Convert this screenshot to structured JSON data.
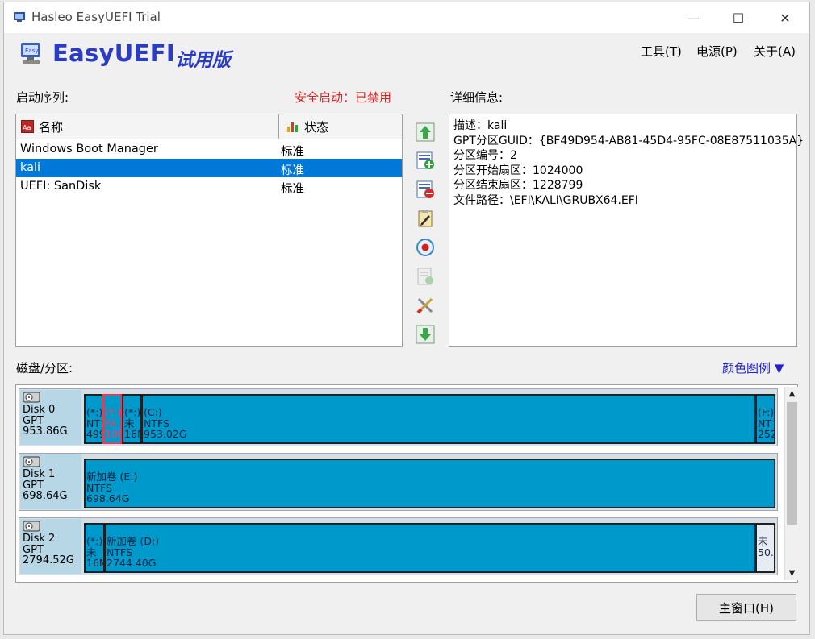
{
  "window": {
    "title": "Hasleo EasyUEFI Trial",
    "controls": {
      "minimize": "—",
      "maximize": "☐",
      "close": "✕"
    }
  },
  "header": {
    "brand": "EasyUEFI",
    "brand_suffix": "试用版",
    "menu": [
      "工具(T)",
      "电源(P)",
      "关于(A)"
    ]
  },
  "boot": {
    "label": "启动序列:",
    "secure_boot": "安全启动：已禁用",
    "columns": {
      "name": "名称",
      "status": "状态"
    },
    "entries": [
      {
        "name": "Windows Boot Manager",
        "status": "标准"
      },
      {
        "name": "kali",
        "status": "标准",
        "selected": true
      },
      {
        "name": "UEFI: SanDisk",
        "status": "标准"
      }
    ]
  },
  "toolbar": {
    "icons": [
      "move-up-icon",
      "add-entry-icon",
      "delete-entry-icon",
      "edit-entry-icon",
      "set-one-time-boot-icon",
      "backup-icon",
      "tools-icon",
      "move-down-icon"
    ]
  },
  "details": {
    "label": "详细信息:",
    "lines": [
      "描述：kali",
      "GPT分区GUID：{BF49D954-AB81-45D4-95FC-08E87511035A}",
      "分区编号：2",
      "分区开始扇区：1024000",
      "分区结束扇区：1228799",
      "文件路径：\\EFI\\KALI\\GRUBX64.EFI"
    ]
  },
  "disks": {
    "label": "磁盘/分区:",
    "legend_link": "颜色图例 ▼",
    "list": [
      {
        "name": "Disk 0",
        "type": "GPT",
        "size": "953.86G",
        "partitions": [
          {
            "label": "(*:)",
            "fs": "NT",
            "size": "499",
            "kind": "normal"
          },
          {
            "label": "(*:)",
            "fs": "FA",
            "size": "100",
            "kind": "fat"
          },
          {
            "label": "(*:)",
            "fs": "未",
            "size": "16M",
            "kind": "normal"
          },
          {
            "label": "(C:)",
            "fs": "NTFS",
            "size": "953.02G",
            "kind": "normal"
          },
          {
            "label": "(F:)",
            "fs": "NT",
            "size": "252",
            "kind": "normal"
          }
        ]
      },
      {
        "name": "Disk 1",
        "type": "GPT",
        "size": "698.64G",
        "partitions": [
          {
            "label": "新加卷 (E:)",
            "fs": "NTFS",
            "size": "698.64G",
            "kind": "normal"
          }
        ]
      },
      {
        "name": "Disk 2",
        "type": "GPT",
        "size": "2794.52G",
        "partitions": [
          {
            "label": "(*:)",
            "fs": "未",
            "size": "16M",
            "kind": "normal"
          },
          {
            "label": "新加卷 (D:)",
            "fs": "NTFS",
            "size": "2744.40G",
            "kind": "normal"
          },
          {
            "label": "未",
            "fs": "50.",
            "size": "",
            "kind": "unalloc"
          }
        ]
      }
    ]
  },
  "footer": {
    "main_window_button": "主窗口(H)"
  },
  "colors": {
    "brand": "#2a3bc4",
    "secure_text": "#e02020",
    "selection": "#0078d7",
    "partition": "#0099cc",
    "fat_border": "#ff2f55"
  }
}
